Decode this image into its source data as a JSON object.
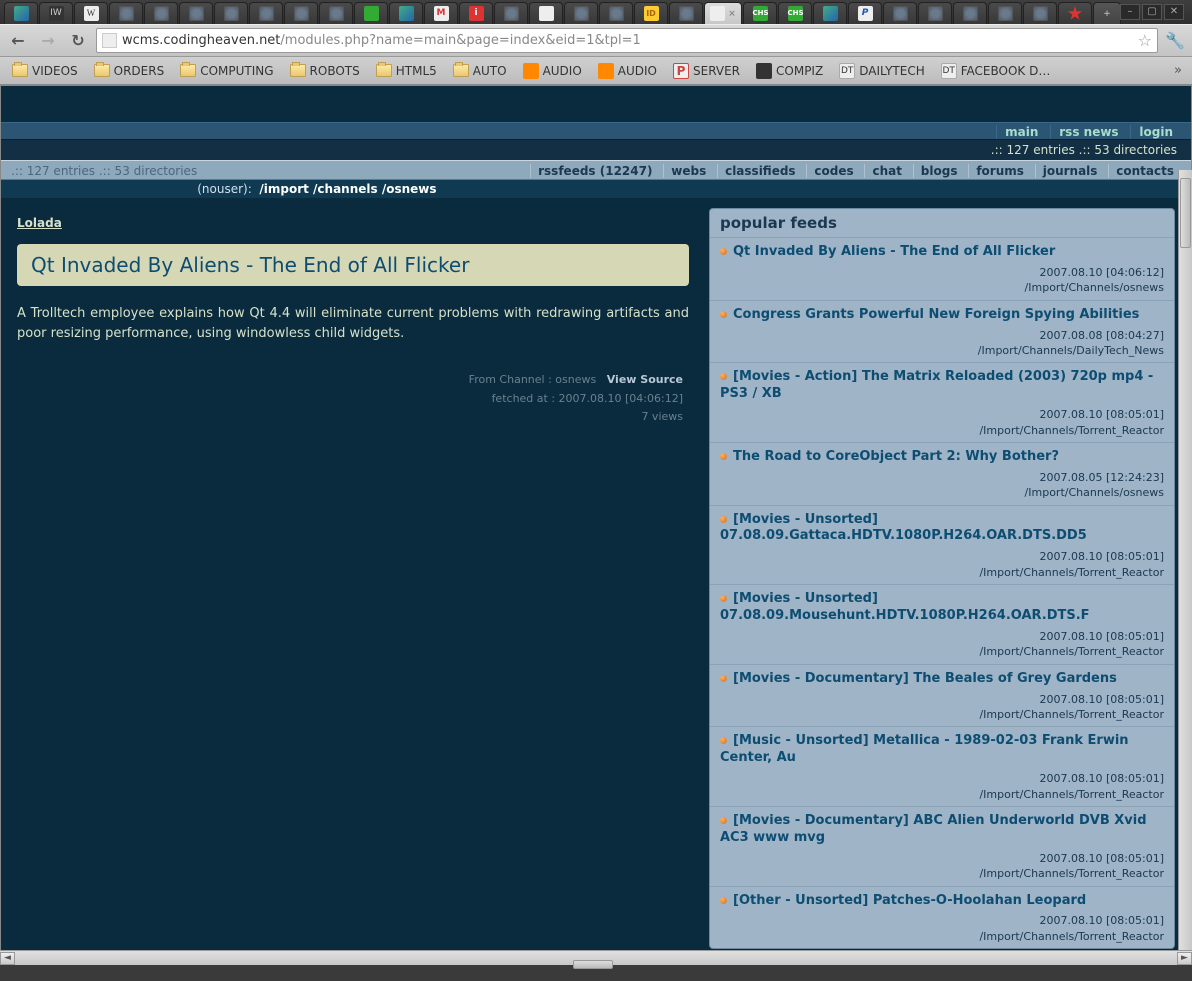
{
  "url": {
    "domain": "wcms.codingheaven.net",
    "path": "/modules.php?name=main&page=index&eid=1&tpl=1"
  },
  "bookmarks": [
    "VIDEOS",
    "ORDERS",
    "COMPUTING",
    "ROBOTS",
    "HTML5",
    "AUTO",
    "AUDIO",
    "AUDIO",
    "SERVER",
    "COMPIZ",
    "DAILYTECH",
    "FACEBOOK D…"
  ],
  "top_nav": {
    "items": [
      "main",
      "rss news",
      "login"
    ]
  },
  "info_line": ".:: 127 entries .:: 53 directories",
  "sub_nav": {
    "info": ".:: 127 entries .:: 53 directories",
    "items": [
      "rssfeeds (12247)",
      "webs",
      "classifieds",
      "codes",
      "chat",
      "blogs",
      "forums",
      "journals",
      "contacts"
    ]
  },
  "breadcrumb": {
    "prefix": "(nouser):",
    "path": "/import /channels /osnews"
  },
  "lolada": "Lolada",
  "article": {
    "title": "Qt Invaded By Aliens - The End of All Flicker",
    "body": "A Trolltech employee explains how Qt 4.4 will eliminate current problems with redrawing artifacts and poor resizing performance, using windowless child widgets.",
    "channel_label": "From Channel :",
    "channel": "osnews",
    "view_source": "View Source",
    "fetched": "fetched at : 2007.08.10 [04:06:12]",
    "views": "7 views"
  },
  "panel_title": "popular feeds",
  "feeds": [
    {
      "title": "Qt Invaded By Aliens - The End of All Flicker",
      "date": "2007.08.10 [04:06:12]",
      "path": "/Import/Channels/osnews"
    },
    {
      "title": "Congress Grants Powerful New Foreign Spying Abilities",
      "date": "2007.08.08 [08:04:27]",
      "path": "/Import/Channels/DailyTech_News"
    },
    {
      "title": "[Movies - Action] The Matrix Reloaded (2003) 720p mp4 - PS3 / XB",
      "date": "2007.08.10 [08:05:01]",
      "path": "/Import/Channels/Torrent_Reactor"
    },
    {
      "title": "The Road to CoreObject Part 2: Why Bother?",
      "date": "2007.08.05 [12:24:23]",
      "path": "/Import/Channels/osnews"
    },
    {
      "title": "[Movies - Unsorted] 07.08.09.Gattaca.HDTV.1080P.H264.OAR.DTS.DD5",
      "date": "2007.08.10 [08:05:01]",
      "path": "/Import/Channels/Torrent_Reactor"
    },
    {
      "title": "[Movies - Unsorted] 07.08.09.Mousehunt.HDTV.1080P.H264.OAR.DTS.F",
      "date": "2007.08.10 [08:05:01]",
      "path": "/Import/Channels/Torrent_Reactor"
    },
    {
      "title": "[Movies - Documentary] The Beales of Grey Gardens",
      "date": "2007.08.10 [08:05:01]",
      "path": "/Import/Channels/Torrent_Reactor"
    },
    {
      "title": "[Music - Unsorted] Metallica - 1989-02-03 Frank Erwin Center, Au",
      "date": "2007.08.10 [08:05:01]",
      "path": "/Import/Channels/Torrent_Reactor"
    },
    {
      "title": "[Movies - Documentary] ABC Alien Underworld DVB Xvid AC3 www mvg",
      "date": "2007.08.10 [08:05:01]",
      "path": "/Import/Channels/Torrent_Reactor"
    },
    {
      "title": "[Other - Unsorted] Patches-O-Hoolahan Leopard",
      "date": "2007.08.10 [08:05:01]",
      "path": "/Import/Channels/Torrent_Reactor"
    }
  ]
}
